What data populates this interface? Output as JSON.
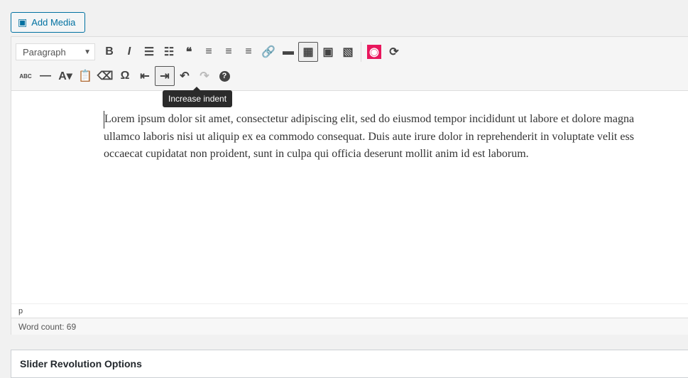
{
  "add_media": {
    "label": "Add Media",
    "icon": "media-icon"
  },
  "toolbar": {
    "format_select": "Paragraph",
    "row1": [
      {
        "name": "bold",
        "glyph": "B"
      },
      {
        "name": "italic",
        "glyph": "I"
      },
      {
        "name": "bulleted-list",
        "glyph": "☰"
      },
      {
        "name": "numbered-list",
        "glyph": "☷"
      },
      {
        "name": "blockquote",
        "glyph": "❝"
      },
      {
        "name": "align-left",
        "glyph": "≡"
      },
      {
        "name": "align-center",
        "glyph": "≡"
      },
      {
        "name": "align-right",
        "glyph": "≡"
      },
      {
        "name": "insert-link",
        "glyph": "🔗"
      },
      {
        "name": "read-more",
        "glyph": "▬"
      },
      {
        "name": "toolbar-toggle",
        "glyph": "▦",
        "active": true
      },
      {
        "name": "preview",
        "glyph": "▣"
      },
      {
        "name": "gallery",
        "glyph": "▧"
      }
    ],
    "row1_extra": [
      {
        "name": "slider-revolution",
        "glyph": "◉",
        "color": "#e8175d"
      },
      {
        "name": "refresh",
        "glyph": "⟳"
      }
    ],
    "row2": [
      {
        "name": "strikethrough",
        "glyph": "ABC"
      },
      {
        "name": "horizontal-line",
        "glyph": "—"
      },
      {
        "name": "text-color",
        "glyph": "A▾"
      },
      {
        "name": "paste-text",
        "glyph": "📋"
      },
      {
        "name": "clear-formatting",
        "glyph": "⌫"
      },
      {
        "name": "special-character",
        "glyph": "Ω"
      },
      {
        "name": "decrease-indent",
        "glyph": "⇤"
      },
      {
        "name": "increase-indent",
        "glyph": "⇥",
        "active": true
      },
      {
        "name": "undo",
        "glyph": "↶"
      },
      {
        "name": "redo",
        "glyph": "↷",
        "disabled": true
      },
      {
        "name": "help",
        "glyph": "?"
      }
    ],
    "tooltip": "Increase indent"
  },
  "content": {
    "lines": [
      "Lorem ipsum dolor sit amet, consectetur adipiscing elit, sed do eiusmod tempor incididunt ut labore et dolore magna",
      "ullamco laboris nisi ut aliquip ex ea commodo consequat. Duis aute irure dolor in reprehenderit in voluptate velit ess",
      "occaecat cupidatat non proident, sunt in culpa qui officia deserunt mollit anim id est laborum."
    ]
  },
  "status": {
    "path": "p",
    "word_count": "Word count: 69"
  },
  "slider_box": {
    "title": "Slider Revolution Options"
  }
}
